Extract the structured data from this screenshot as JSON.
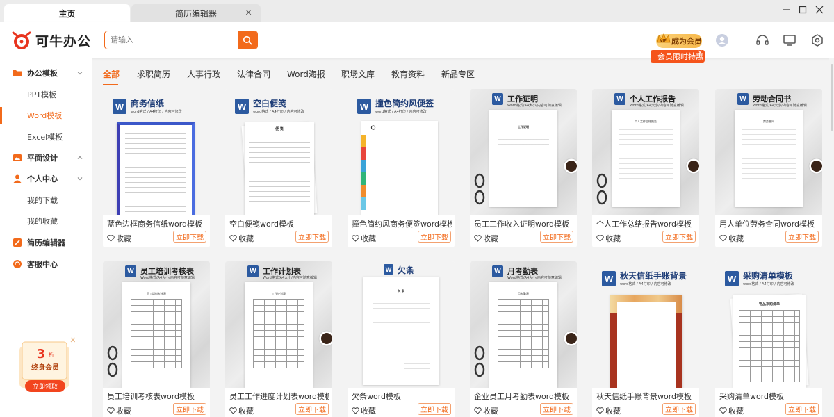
{
  "tabs": [
    {
      "label": "主页"
    },
    {
      "label": "简历编辑器"
    }
  ],
  "window": {
    "tab_close": "×"
  },
  "brand": {
    "name": "可牛办公",
    "color": "#f26a1b"
  },
  "search": {
    "placeholder": "请输入"
  },
  "header": {
    "vip_label": "成为会员",
    "vip_badge": "VIP",
    "promo_label": "会员限时特惠",
    "promo_close": "×"
  },
  "sidebar": {
    "office": "办公模板",
    "ppt": "PPT模板",
    "word": "Word模板",
    "excel": "Excel模板",
    "design": "平面设计",
    "personal": "个人中心",
    "downloads": "我的下载",
    "favorites": "我的收藏",
    "resume": "简历编辑器",
    "service": "客服中心"
  },
  "promo": {
    "discount": "3",
    "discount_unit": "折",
    "label": "终身会员",
    "button": "立即领取"
  },
  "categories": [
    "全部",
    "求职简历",
    "人事行政",
    "法律合同",
    "Word海报",
    "职场文库",
    "教育资料",
    "新品专区"
  ],
  "card_common": {
    "fav": "收藏",
    "download": "立即下载",
    "word_sub": "word格式 / A4打印 / 内容可修改",
    "word_sub2": "Word格式/A4大小/内容可随意编辑"
  },
  "cards": [
    {
      "title": "蓝色边框商务信纸word模板",
      "thumb_title": "商务信纸"
    },
    {
      "title": "空白便笺word模板",
      "thumb_title": "空白便笺",
      "doc_head": "便 笺"
    },
    {
      "title": "撞色简约风商务便签word模板",
      "thumb_title": "撞色简约风便签"
    },
    {
      "title": "员工工作收入证明word模板",
      "thumb_title": "工作证明",
      "doc_head": "工作证明"
    },
    {
      "title": "个人工作总结报告word模板",
      "thumb_title": "个人工作报告",
      "doc_head": "个人工作总结报告"
    },
    {
      "title": "用人单位劳务合同word模板",
      "thumb_title": "劳动合同书",
      "doc_head": "劳务合同"
    },
    {
      "title": "员工培训考核表word模板",
      "thumb_title": "员工培训考核表",
      "doc_head": "员工培训考核表"
    },
    {
      "title": "员工工作进度计划表word模板",
      "thumb_title": "工作计划表",
      "doc_head": "工作计划表"
    },
    {
      "title": "欠条word模板",
      "thumb_title": "欠条",
      "doc_head": "欠 条"
    },
    {
      "title": "企业员工月考勤表word模板",
      "thumb_title": "月考勤表",
      "doc_head": "月考勤表"
    },
    {
      "title": "秋天信纸手账背景word模板",
      "thumb_title": "秋天信纸手账背景"
    },
    {
      "title": "采购清单word模板",
      "thumb_title": "采购清单模板",
      "doc_head": "物品采购清单"
    }
  ]
}
